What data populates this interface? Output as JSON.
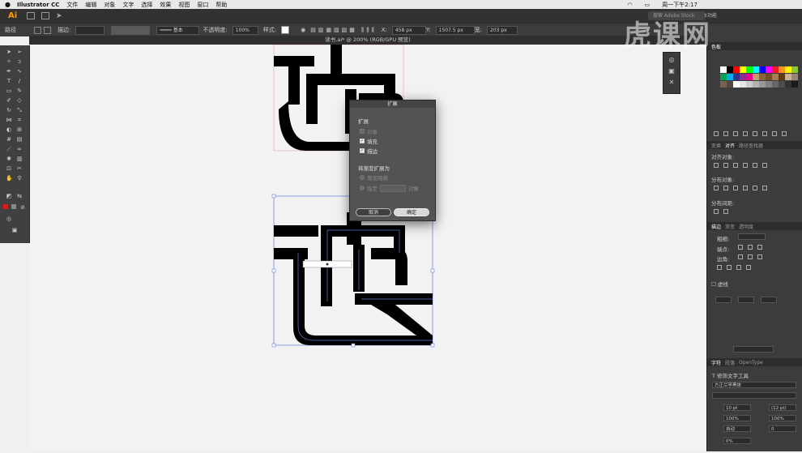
{
  "menubar": {
    "apple": "",
    "app_name": "Illustrator CC",
    "items": [
      "文件",
      "编辑",
      "对象",
      "文字",
      "选择",
      "效果",
      "视图",
      "窗口",
      "帮助"
    ],
    "clock": "周一下午2:17"
  },
  "appbar": {
    "logo": "Ai",
    "search_placeholder": "搜索 Adobe Stock",
    "workspace": "基本功能"
  },
  "controlbar": {
    "path_label": "路径",
    "stroke_label": "描边:",
    "stroke_style": "基本",
    "opacity_label": "不透明度:",
    "opacity_value": "100%",
    "style_label": "样式:",
    "x_label": "X:",
    "x_value": "458 px",
    "y_label": "Y:",
    "y_value": "1507.5 px",
    "w_label": "宽:",
    "w_value": "203 px"
  },
  "document": {
    "tab_title": "读书.ai* @ 200% (RGB/GPU 预览)",
    "artwork_char": "读"
  },
  "dialog": {
    "title": "扩展",
    "section1": "扩展",
    "object_label": "对象",
    "fill_label": "填充",
    "stroke_label": "描边",
    "fill_checked": true,
    "stroke_checked": true,
    "section2": "将渐变扩展为",
    "gradient_mesh": "渐变网格",
    "specify": "指定",
    "objects_suffix": "对象",
    "cancel": "取消",
    "ok": "确定"
  },
  "panels": {
    "swatches_tab": "色板",
    "transform_tab": "变换",
    "align_tab": "对齐",
    "pathfinder_tab": "路径查找器",
    "align_objects": "对齐对象:",
    "distribute_objects": "分布对象:",
    "distribute_spacing": "分布间距:",
    "stroke_tab": "描边",
    "gradient_tab": "渐变",
    "transparency_tab": "透明度",
    "stroke_weight": "粗细:",
    "stroke_cap": "端点:",
    "stroke_corner": "边角:",
    "dashed_line": "虚线",
    "char_tab": "字符",
    "para_tab": "段落",
    "opentype_tab": "OpenType",
    "touch_type": "修饰文字工具",
    "font_name": "方正兰亭黑体",
    "font_size": "10 pt",
    "leading": "(12 pt)",
    "scale_v": "100%",
    "scale_h": "100%",
    "kerning": "自动",
    "tracking": "0",
    "baseline": "0%"
  },
  "swatch_colors": [
    "#ffffff",
    "#000000",
    "#ff0000",
    "#ffff00",
    "#00ff00",
    "#00ffff",
    "#0000ff",
    "#ff00ff",
    "#ed1c24",
    "#f7941d",
    "#fff200",
    "#8dc63f",
    "#00a651",
    "#00aeef",
    "#2e3192",
    "#92278f",
    "#ec008c",
    "#c69c6d",
    "#8c6239",
    "#754c24",
    "#a67c52",
    "#603913",
    "#c7b299",
    "#998675",
    "#736357",
    "#534741",
    "#ffffff",
    "#e6e6e6",
    "#cccccc",
    "#b3b3b3",
    "#999999",
    "#808080",
    "#666666",
    "#4d4d4d",
    "#333333",
    "#1a1a1a"
  ],
  "watermark": "虎课网"
}
